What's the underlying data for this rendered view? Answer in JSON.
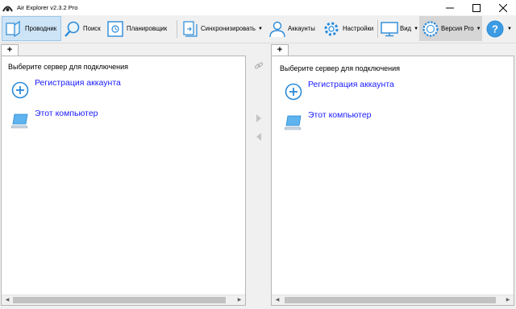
{
  "window": {
    "title": "Air Explorer v2.3.2 Pro"
  },
  "toolbar": {
    "explorer": "Проводник",
    "search": "Поиск",
    "scheduler": "Планировщик",
    "sync": "Синхронизировать",
    "accounts": "Аккаунты",
    "settings": "Настройки",
    "view": "Вид",
    "pro": "Версия Pro"
  },
  "tabs": {
    "add": "+"
  },
  "left_pane": {
    "header": "Выберите сервер для подключения",
    "items": [
      {
        "label": "Регистрация аккаунта",
        "icon": "add-circle-icon"
      },
      {
        "label": "Этот компьютер",
        "icon": "computer-icon"
      }
    ]
  },
  "right_pane": {
    "header": "Выберите сервер для подключения",
    "items": [
      {
        "label": "Регистрация аккаунта",
        "icon": "add-circle-icon"
      },
      {
        "label": "Этот компьютер",
        "icon": "computer-icon"
      }
    ]
  },
  "colors": {
    "link": "#1a1aff",
    "icon_blue": "#2a8ad8",
    "active_bg": "#cde4f7"
  }
}
